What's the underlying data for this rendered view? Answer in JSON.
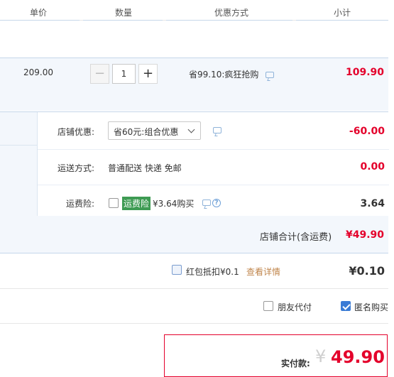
{
  "header": {
    "col_unit_price": "单价",
    "col_quantity": "数量",
    "col_discount": "优惠方式",
    "col_subtotal": "小计"
  },
  "item": {
    "unit_price": "209.00",
    "quantity": "1",
    "minus_label": "−",
    "plus_label": "+",
    "promotion": "省99.10:疯狂抢购",
    "subtotal": "109.90"
  },
  "shop": {
    "discount_label": "店铺优惠:",
    "discount_selected": "省60元:组合优惠",
    "discount_amount": "-60.00",
    "shipping_label": "运送方式:",
    "shipping_value": "普通配送 快递 免邮",
    "shipping_amount": "0.00",
    "insurance_label": "运费险:",
    "insurance_tag": "运费险",
    "insurance_offer": "¥3.64购买",
    "insurance_amount": "3.64",
    "total_label": "店铺合计(含运费)",
    "total_value": "¥49.90"
  },
  "redpacket": {
    "label": "红包抵扣¥0.1",
    "details_link": "查看详情",
    "amount": "¥0.10"
  },
  "options": {
    "friend_pay": "朋友代付",
    "anonymous": "匿名购买",
    "anonymous_checked": true
  },
  "payment": {
    "label": "实付款:",
    "currency": "¥",
    "amount": "49.90"
  },
  "colors": {
    "accent_red": "#e4002b",
    "brand_blue": "#3a7bd5",
    "tag_green": "#3e9b53"
  }
}
